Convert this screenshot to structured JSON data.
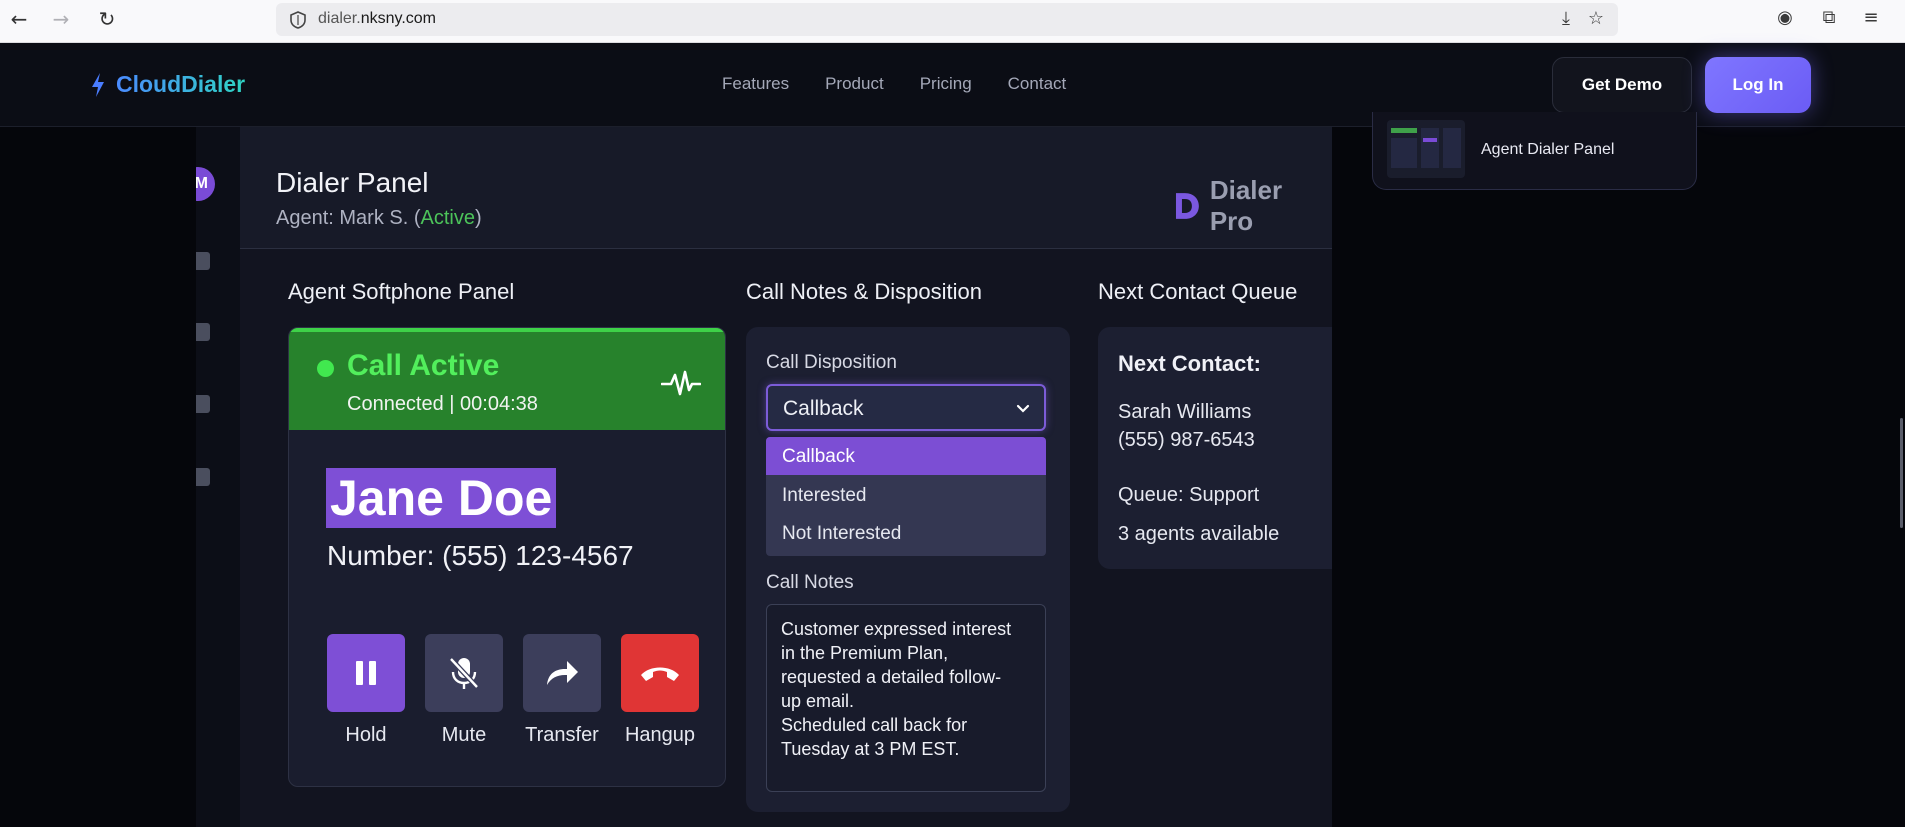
{
  "browser": {
    "url_prefix": "dialer.",
    "url_domain": "nksny.com"
  },
  "site": {
    "brand": "CloudDialer",
    "nav": [
      "Features",
      "Product",
      "Pricing",
      "Contact"
    ],
    "get_demo": "Get Demo",
    "login": "Log In"
  },
  "side_card": {
    "label": "Agent Dialer Panel"
  },
  "dialer": {
    "avatar_letter": "M",
    "title": "Dialer Panel",
    "agent_prefix": "Agent: Mark S. (",
    "agent_status": "Active",
    "agent_suffix": ")",
    "brand": "Dialer Pro",
    "softphone": {
      "section_title": "Agent Softphone Panel",
      "status": "Call Active",
      "sub_status": "Connected | 00:04:38",
      "caller_name": "Jane Doe",
      "caller_number": "Number: (555) 123-4567",
      "controls": [
        {
          "label": "Hold",
          "icon": "pause-icon",
          "color": "#7e4fd6"
        },
        {
          "label": "Mute",
          "icon": "mic-off-icon",
          "color": "#3c3e5b"
        },
        {
          "label": "Transfer",
          "icon": "forward-arrow-icon",
          "color": "#3c3e5b"
        },
        {
          "label": "Hangup",
          "icon": "phone-hangup-icon",
          "color": "#e03535"
        }
      ]
    },
    "notes": {
      "section_title": "Call Notes & Disposition",
      "disposition_label": "Call Disposition",
      "selected": "Callback",
      "options": [
        "Callback",
        "Interested",
        "Not Interested"
      ],
      "notes_label": "Call Notes",
      "notes_lines": [
        "Customer expressed interest",
        "in the Premium Plan,",
        "requested a detailed follow-",
        "up email.",
        "Scheduled call back for",
        "Tuesday at 3 PM EST."
      ]
    },
    "queue": {
      "section_title": "Next Contact Queue",
      "heading": "Next Contact:",
      "name": "Sarah Williams",
      "phone": "(555) 987-6543",
      "queue": "Queue: Support",
      "agents": "3 agents available"
    }
  },
  "colors": {
    "accent": "#7c4ed4",
    "call_active": "#27822c",
    "hangup": "#e03535",
    "status_active": "#4cc35a"
  }
}
